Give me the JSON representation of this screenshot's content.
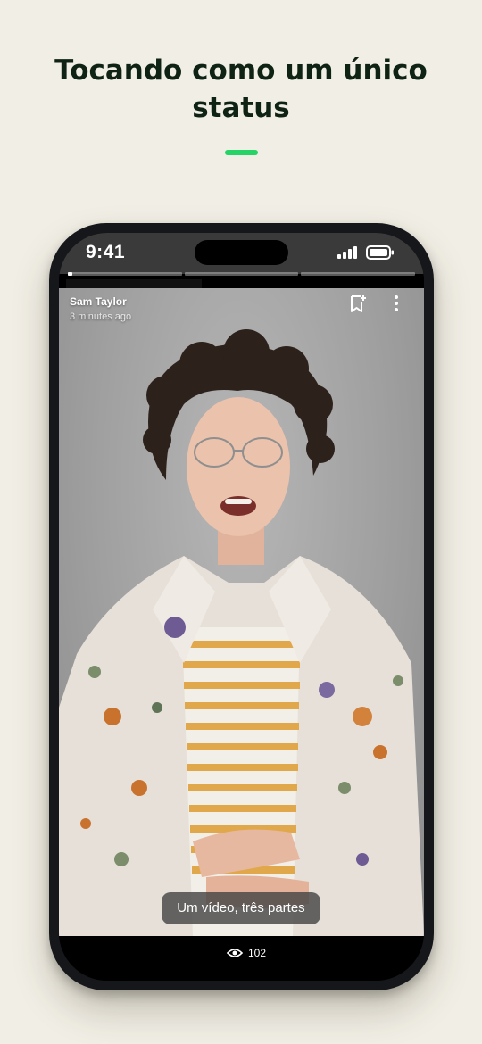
{
  "headline": {
    "line1": "Tocando como um único",
    "line2": "status"
  },
  "colors": {
    "background": "#f1eee5",
    "headline": "#0f2315",
    "accent": "#25d366"
  },
  "statusbar": {
    "time": "9:41",
    "icons": [
      "signal-icon",
      "battery-icon"
    ]
  },
  "status_viewer": {
    "progress_segments": [
      0.04,
      0,
      0
    ],
    "sender_name": "Sam Taylor",
    "timestamp": "3 minutes ago",
    "caption": "Um vídeo, três partes",
    "view_count": "102",
    "icons": [
      "bookmark-icon",
      "more-vertical-icon",
      "eye-icon"
    ]
  }
}
